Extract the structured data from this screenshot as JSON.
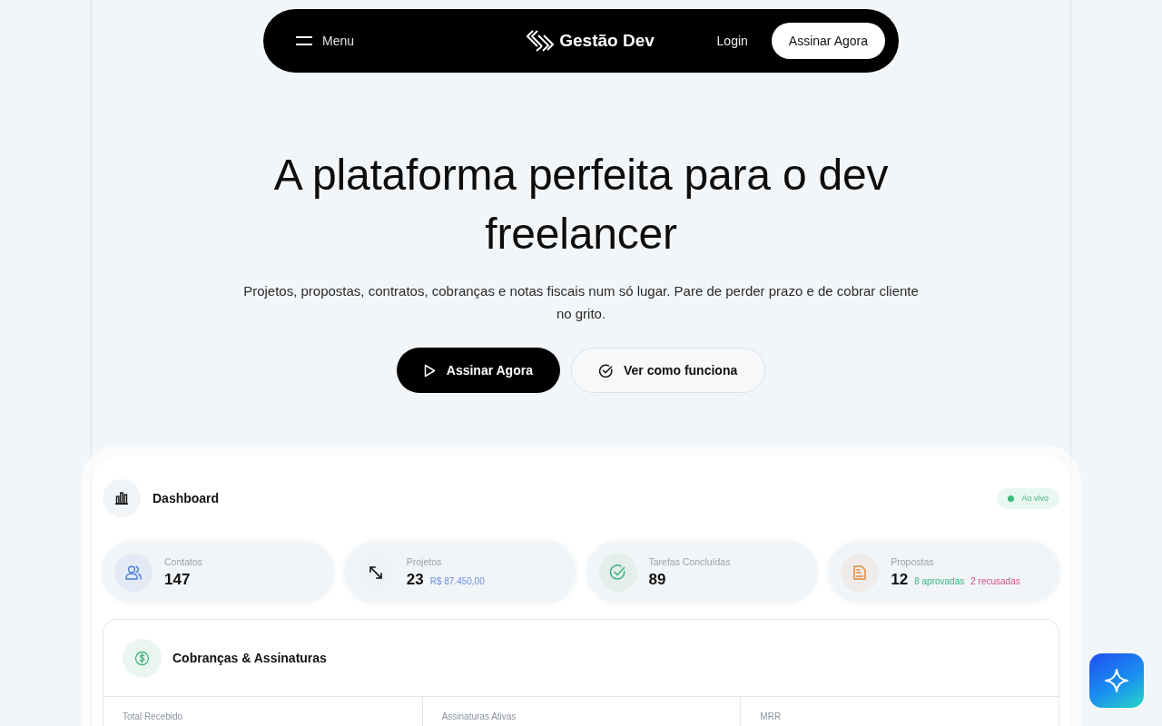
{
  "nav": {
    "menu": "Menu",
    "brand": "Gestão Dev",
    "login": "Login",
    "cta": "Assinar Agora"
  },
  "hero": {
    "title": "A plataforma perfeita para o dev freelancer",
    "subtitle": "Projetos, propostas, contratos, cobranças e notas fiscais num só lugar. Pare de perder prazo e de cobrar cliente no grito.",
    "buttons": [
      {
        "label": "Assinar Agora",
        "kind": "primary"
      },
      {
        "label": "Ver como funciona",
        "kind": "secondary"
      }
    ]
  },
  "dashboard": {
    "title": "Dashboard",
    "status": "Ao vivo",
    "stats": [
      {
        "kind": "contacts",
        "label": "Contatos",
        "value": "147"
      },
      {
        "kind": "projects",
        "label": "Projetos",
        "value": "23",
        "notes": [
          {
            "kind": "amount",
            "text": "R$ 87.450,00"
          }
        ]
      },
      {
        "kind": "tasks",
        "label": "Tarefas Concluídas",
        "value": "89"
      },
      {
        "kind": "proposals",
        "label": "Propostas",
        "value": "12",
        "notes": [
          {
            "kind": "approved",
            "text": "8 aprovadas"
          },
          {
            "kind": "rejected",
            "text": "2 recusadas"
          }
        ]
      }
    ],
    "billing": {
      "title": "Cobranças & Assinaturas",
      "metrics": [
        {
          "label": "Total Recebido"
        },
        {
          "label": "Assinaturas Ativas"
        },
        {
          "label": "MRR"
        }
      ]
    }
  }
}
